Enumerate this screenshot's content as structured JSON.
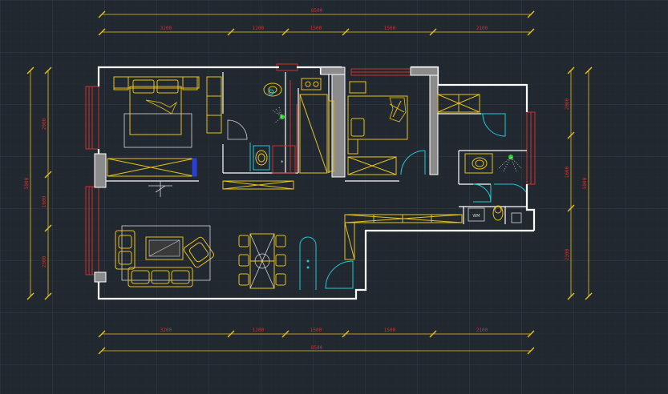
{
  "drawing": {
    "top_overall_dim": "8500",
    "top_segment_dims": [
      "3200",
      "1200",
      "1500",
      "1500",
      "2100"
    ],
    "bottom_overall_dim": "8500",
    "bottom_segment_dims": [
      "3200",
      "1200",
      "1500",
      "1500",
      "2100"
    ],
    "left_overall_dim": "5900",
    "left_segment_dims": [
      "2000",
      "1600",
      "2300"
    ],
    "right_overall_dim": "5900",
    "right_segment_dims": [
      "2000",
      "1600",
      "2300"
    ]
  },
  "colors": {
    "background": "#212830",
    "grid": "#2c3540",
    "walls": "#ffffff",
    "furniture": "#e8c21a",
    "fixtures": "#1fc9d6",
    "dimensions": "#c8342f",
    "accent_blue": "#2b3fd6"
  }
}
